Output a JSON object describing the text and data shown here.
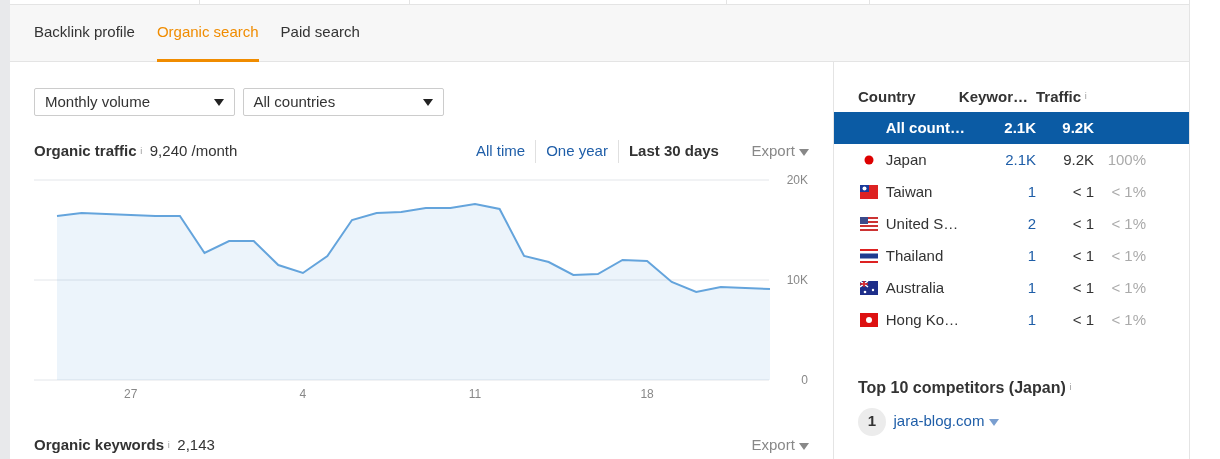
{
  "tabs": [
    {
      "label": "Backlink profile",
      "selected": false
    },
    {
      "label": "Organic search",
      "selected": true
    },
    {
      "label": "Paid search",
      "selected": false
    }
  ],
  "filters": [
    {
      "value": "Monthly volume"
    },
    {
      "value": "All countries"
    }
  ],
  "traffic": {
    "title": "Organic traffic",
    "info": "i",
    "value": "9,240 /month",
    "ranges": [
      {
        "label": "All time",
        "selected": false
      },
      {
        "label": "One year",
        "selected": false
      },
      {
        "label": "Last 30 days",
        "selected": true
      }
    ],
    "export": "Export",
    "chart_data": {
      "type": "area",
      "categories": [
        null,
        null,
        null,
        "27",
        null,
        null,
        null,
        null,
        null,
        null,
        "4",
        null,
        null,
        null,
        null,
        null,
        null,
        "11",
        null,
        null,
        null,
        null,
        null,
        null,
        "18",
        null,
        null,
        null,
        null,
        null
      ],
      "series": [
        {
          "color": "#64a4dc",
          "values": [
            16400,
            16700,
            16600,
            16500,
            16400,
            16400,
            12700,
            13900,
            13900,
            11500,
            10700,
            12400,
            16000,
            16700,
            16800,
            17200,
            17200,
            17600,
            17100,
            12400,
            11800,
            10500,
            10600,
            12000,
            11900,
            9800,
            8800,
            9300,
            9200,
            9100
          ]
        }
      ],
      "ylim": [
        0,
        20000
      ],
      "yticks": [
        {
          "value": 0,
          "label": "0"
        },
        {
          "value": 10000,
          "label": "10K"
        },
        {
          "value": 20000,
          "label": "20K"
        }
      ]
    }
  },
  "keywords": {
    "title": "Organic keywords",
    "info": "i",
    "value": "2,143",
    "export": "Export"
  },
  "countries": {
    "columns": [
      "Country",
      "Keywor…",
      "Traffic"
    ],
    "traffic_info": "i",
    "rows": [
      {
        "kind": "plain",
        "name": "All count…",
        "keywords": "2.1K",
        "traffic": "9.2K",
        "selected": true
      },
      {
        "kind": "dot",
        "name": "Japan",
        "keywords": "2.1K",
        "traffic": "9.2K",
        "share": "100%",
        "selected": false
      },
      {
        "kind": "taiwan",
        "name": "Taiwan",
        "keywords": "1",
        "traffic": "< 1",
        "share": "< 1%",
        "selected": false
      },
      {
        "kind": "usa",
        "name": "United S…",
        "keywords": "2",
        "traffic": "< 1",
        "share": "< 1%",
        "selected": false
      },
      {
        "kind": "thailand",
        "name": "Thailand",
        "keywords": "1",
        "traffic": "< 1",
        "share": "< 1%",
        "selected": false
      },
      {
        "kind": "australia",
        "name": "Australia",
        "keywords": "1",
        "traffic": "< 1",
        "share": "< 1%",
        "selected": false
      },
      {
        "kind": "hongkong",
        "name": "Hong Ko…",
        "keywords": "1",
        "traffic": "< 1",
        "share": "< 1%",
        "selected": false
      }
    ]
  },
  "competitors": {
    "title": "Top 10 competitors (Japan)",
    "info": "i",
    "items": [
      {
        "rank": "1",
        "domain": "jara-blog.com"
      }
    ]
  }
}
